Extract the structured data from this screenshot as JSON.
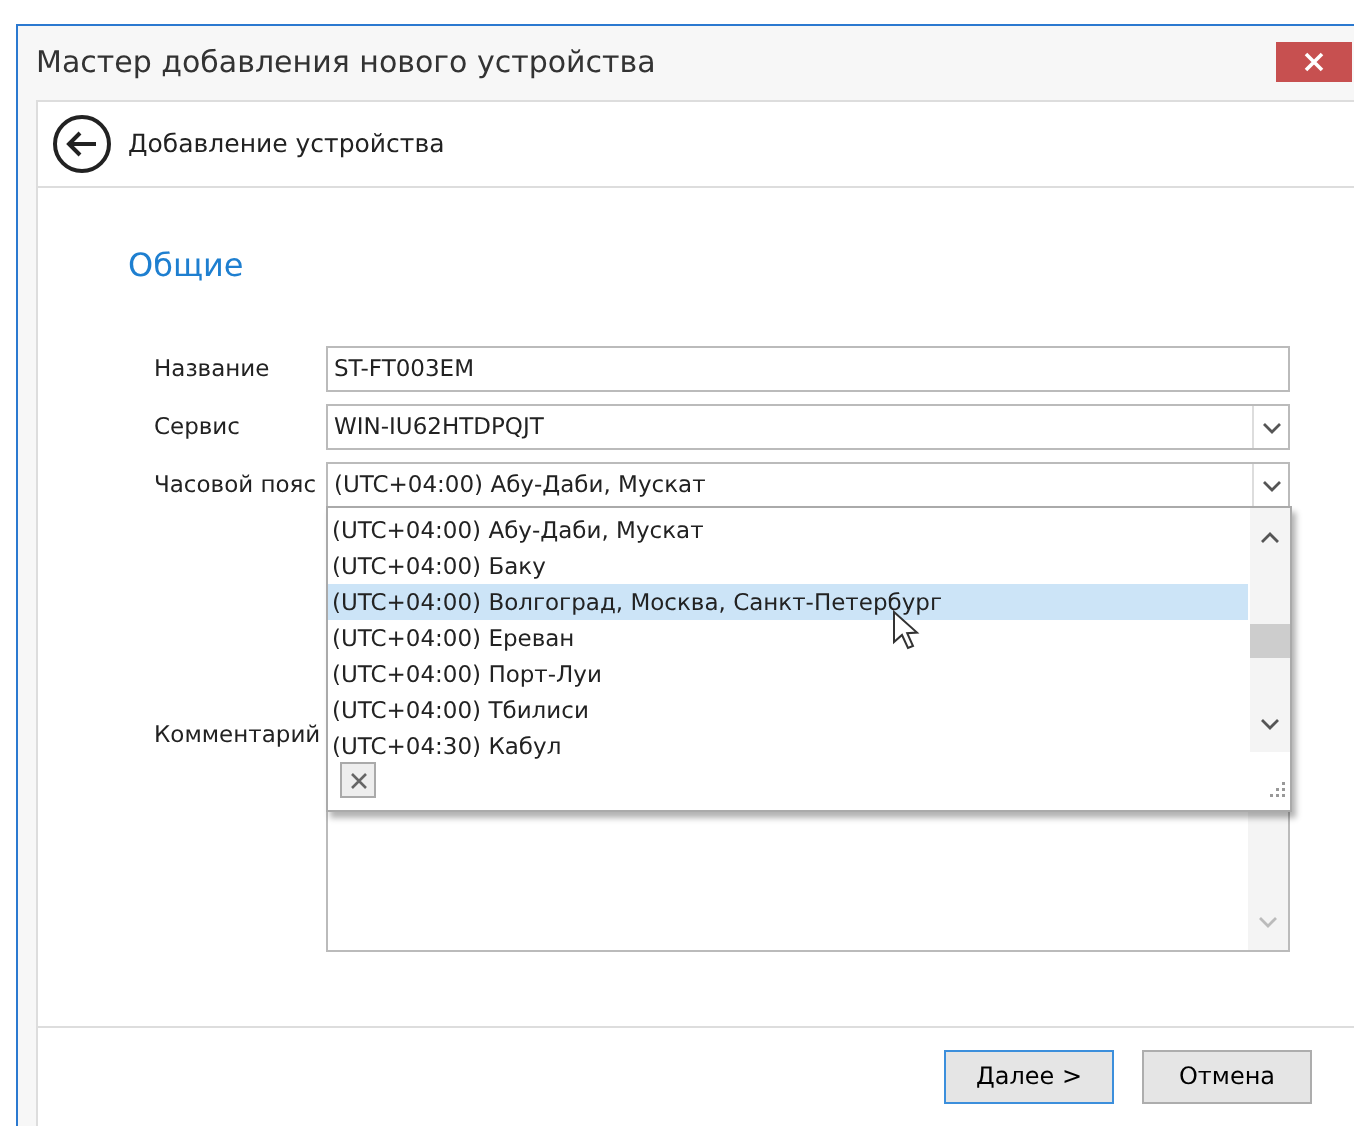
{
  "window": {
    "title": "Мастер добавления нового устройства"
  },
  "header": {
    "title": "Добавление устройства"
  },
  "section": {
    "title": "Общие"
  },
  "fields": [
    {
      "kind": "text",
      "label": "Название",
      "value": "ST-FT003EM"
    },
    {
      "kind": "select",
      "label": "Сервис",
      "value": "WIN-IU62HTDPQJT",
      "expanded": false
    },
    {
      "kind": "select",
      "label": "Часовой пояс",
      "value": "(UTC+04:00) Абу-Даби, Мускат",
      "expanded": true,
      "options": [
        {
          "label": "(UTC+04:00) Абу-Даби, Мускат",
          "highlighted": false
        },
        {
          "label": "(UTC+04:00) Баку",
          "highlighted": false
        },
        {
          "label": "(UTC+04:00) Волгоград, Москва, Санкт-Петербург",
          "highlighted": true
        },
        {
          "label": "(UTC+04:00) Ереван",
          "highlighted": false
        },
        {
          "label": "(UTC+04:00) Порт-Луи",
          "highlighted": false
        },
        {
          "label": "(UTC+04:00) Тбилиси",
          "highlighted": false
        },
        {
          "label": "(UTC+04:30) Кабул",
          "highlighted": false
        }
      ]
    },
    {
      "kind": "textarea",
      "label": "Комментарий"
    }
  ],
  "buttons": [
    {
      "label": "Далее >",
      "default": true
    },
    {
      "label": "Отмена",
      "default": false
    }
  ]
}
